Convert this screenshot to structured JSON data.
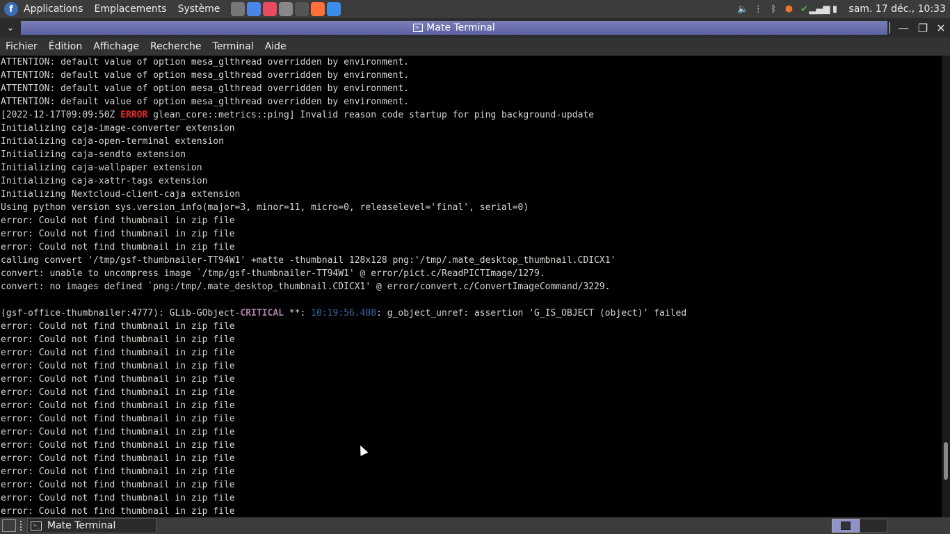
{
  "top_panel": {
    "menus": [
      "Applications",
      "Emplacements",
      "Système"
    ],
    "launchers": [
      {
        "icon": "file-manager-icon",
        "color": "#777777"
      },
      {
        "icon": "chromium-icon",
        "color": "#4a86e8"
      },
      {
        "icon": "software-icon",
        "color": "#e84a5f"
      },
      {
        "icon": "text-editor-icon",
        "color": "#888888"
      },
      {
        "icon": "terminal-icon",
        "color": "#555555"
      },
      {
        "icon": "firefox-icon",
        "color": "#ff7139"
      },
      {
        "icon": "mail-icon",
        "color": "#3b8ee8"
      }
    ],
    "clock": "sam. 17 déc., 10:33"
  },
  "window": {
    "title": "Mate Terminal",
    "controls": {
      "minimize": "—",
      "maximize": "❐",
      "close": "✕"
    }
  },
  "menubar": [
    "Fichier",
    "Édition",
    "Affichage",
    "Recherche",
    "Terminal",
    "Aide"
  ],
  "terminal": {
    "lines": [
      "ATTENTION: default value of option mesa_glthread overridden by environment.",
      "ATTENTION: default value of option mesa_glthread overridden by environment.",
      "ATTENTION: default value of option mesa_glthread overridden by environment.",
      "ATTENTION: default value of option mesa_glthread overridden by environment.",
      "Initializing caja-image-converter extension",
      "Initializing caja-open-terminal extension",
      "Initializing caja-sendto extension",
      "Initializing caja-wallpaper extension",
      "Initializing caja-xattr-tags extension",
      "Initializing Nextcloud-client-caja extension",
      "Using python version sys.version_info(major=3, minor=11, micro=0, releaselevel='final', serial=0)",
      "error: Could not find thumbnail in zip file",
      "error: Could not find thumbnail in zip file",
      "error: Could not find thumbnail in zip file",
      "calling convert '/tmp/gsf-thumbnailer-TT94W1' +matte -thumbnail 128x128 png:'/tmp/.mate_desktop_thumbnail.CDICX1'",
      "convert: unable to uncompress image `/tmp/gsf-thumbnailer-TT94W1' @ error/pict.c/ReadPICTImage/1279.",
      "convert: no images defined `png:/tmp/.mate_desktop_thumbnail.CDICX1' @ error/convert.c/ConvertImageCommand/3229.",
      "",
      "error: Could not find thumbnail in zip file",
      "error: Could not find thumbnail in zip file",
      "error: Could not find thumbnail in zip file",
      "error: Could not find thumbnail in zip file",
      "error: Could not find thumbnail in zip file",
      "error: Could not find thumbnail in zip file",
      "error: Could not find thumbnail in zip file",
      "error: Could not find thumbnail in zip file",
      "error: Could not find thumbnail in zip file",
      "error: Could not find thumbnail in zip file",
      "error: Could not find thumbnail in zip file",
      "error: Could not find thumbnail in zip file",
      "error: Could not find thumbnail in zip file",
      "error: Could not find thumbnail in zip file",
      "error: Could not find thumbnail in zip file"
    ],
    "glean_line": {
      "prefix": "[2022-12-17T09:09:50Z ",
      "level": "ERROR",
      "rest": " glean_core::metrics::ping] Invalid reason code startup for ping background-update"
    },
    "glib_line": {
      "prefix": "(gsf-office-thumbnailer:4777): GLib-GObject-",
      "level": "CRITICAL",
      "mid": " **: ",
      "time": "10:19:56.408",
      "rest": ": g_object_unref: assertion 'G_IS_OBJECT (object)' failed"
    }
  },
  "taskbar": {
    "task_label": "Mate Terminal"
  }
}
